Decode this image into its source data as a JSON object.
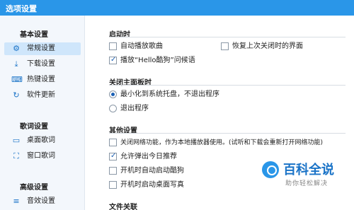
{
  "window": {
    "title": "选项设置"
  },
  "sidebar": {
    "sections": [
      {
        "title": "基本设置",
        "items": [
          {
            "label": "常规设置",
            "icon": "settings-icon",
            "selected": true
          },
          {
            "label": "下载设置",
            "icon": "download-icon",
            "selected": false
          },
          {
            "label": "热键设置",
            "icon": "keyboard-icon",
            "selected": false
          },
          {
            "label": "软件更新",
            "icon": "update-icon",
            "selected": false
          }
        ]
      },
      {
        "title": "歌词设置",
        "items": [
          {
            "label": "桌面歌词",
            "icon": "desktop-lyrics-icon",
            "selected": false
          },
          {
            "label": "窗口歌词",
            "icon": "window-lyrics-icon",
            "selected": false
          }
        ]
      },
      {
        "title": "高级设置",
        "items": [
          {
            "label": "音效设置",
            "icon": "equalizer-icon",
            "selected": false
          }
        ]
      }
    ]
  },
  "main": {
    "startup": {
      "title": "启动时",
      "auto_play": {
        "label": "自动播放歌曲",
        "checked": false
      },
      "restore_ui": {
        "label": "恢复上次关闭时的界面",
        "checked": false
      },
      "greeting": {
        "label": "播放“Hello酷狗”问候语",
        "checked": true
      }
    },
    "close_panel": {
      "title": "关闭主面板时",
      "minimize": {
        "label": "最小化到系统托盘，不退出程序",
        "checked": true
      },
      "exit": {
        "label": "退出程序",
        "checked": false
      }
    },
    "other": {
      "title": "其他设置",
      "offline": {
        "label": "关闭网络功能，作为本地播放器使用。(试听和下载会重新打开网络功能)",
        "checked": false
      },
      "daily_recommend": {
        "label": "允许弹出今日推荐",
        "checked": true
      },
      "boot_start": {
        "label": "开机时自动启动酷狗",
        "checked": false
      },
      "boot_wallpaper": {
        "label": "开机时启动桌面写真",
        "checked": false
      }
    },
    "file_assoc": {
      "title": "文件关联"
    }
  },
  "watermark": {
    "big": "百科全说",
    "small": "助你轻松解决"
  },
  "colors": {
    "titlebar": "#2a96e8",
    "accent": "#1a73c7",
    "selected_bg": "#cfe6fb"
  }
}
